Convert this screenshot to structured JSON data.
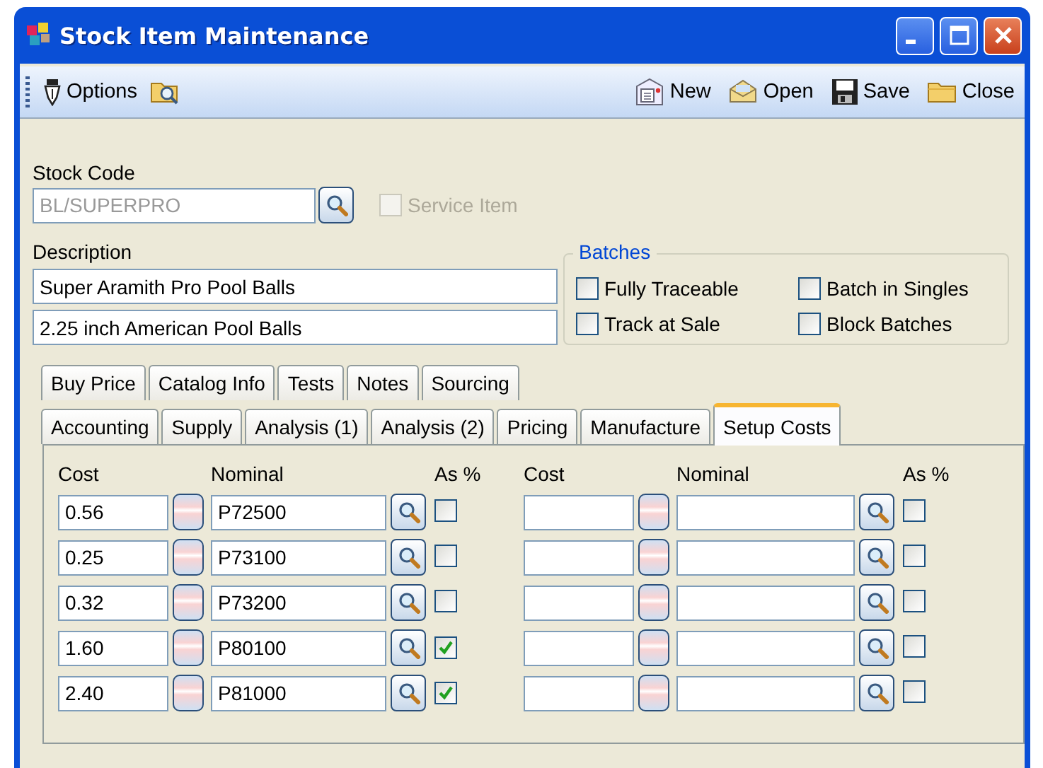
{
  "window": {
    "title": "Stock Item Maintenance"
  },
  "toolbar": {
    "left": [
      {
        "kind": "options",
        "label": "Options"
      },
      {
        "kind": "find"
      }
    ],
    "right": [
      {
        "kind": "new",
        "label": "New"
      },
      {
        "kind": "open",
        "label": "Open"
      },
      {
        "kind": "save",
        "label": "Save"
      },
      {
        "kind": "close",
        "label": "Close"
      }
    ]
  },
  "stock_code": {
    "label": "Stock Code",
    "value": "BL/SUPERPRO",
    "disabled": true
  },
  "service_item": {
    "label": "Service Item",
    "checked": false,
    "disabled": true
  },
  "description": {
    "label": "Description",
    "lines": [
      "Super Aramith Pro Pool Balls",
      "2.25 inch American Pool Balls"
    ]
  },
  "batches": {
    "title": "Batches",
    "options": [
      {
        "label": "Fully Traceable",
        "checked": false
      },
      {
        "label": "Batch in Singles",
        "checked": false
      },
      {
        "label": "Track at Sale",
        "checked": false
      },
      {
        "label": "Block Batches",
        "checked": false
      }
    ]
  },
  "tab_rows": [
    [
      {
        "label": "Buy Price",
        "selected": false
      },
      {
        "label": "Catalog Info",
        "selected": false
      },
      {
        "label": "Tests",
        "selected": false
      },
      {
        "label": "Notes",
        "selected": false
      },
      {
        "label": "Sourcing",
        "selected": false
      }
    ],
    [
      {
        "label": "Accounting",
        "selected": false
      },
      {
        "label": "Supply",
        "selected": false
      },
      {
        "label": "Analysis (1)",
        "selected": false
      },
      {
        "label": "Analysis (2)",
        "selected": false
      },
      {
        "label": "Pricing",
        "selected": false
      },
      {
        "label": "Manufacture",
        "selected": false
      },
      {
        "label": "Setup Costs",
        "selected": true
      }
    ]
  ],
  "setup_costs": {
    "columns": [
      "Cost",
      "Nominal",
      "As %",
      "Cost",
      "Nominal",
      "As %"
    ],
    "rows": [
      {
        "left": {
          "cost": "0.56",
          "nominal": "P72500",
          "as_percent": false
        },
        "right": {
          "as_percent": false
        }
      },
      {
        "left": {
          "cost": "0.25",
          "nominal": "P73100",
          "as_percent": false
        },
        "right": {
          "as_percent": false
        }
      },
      {
        "left": {
          "cost": "0.32",
          "nominal": "P73200",
          "as_percent": false
        },
        "right": {
          "as_percent": false
        }
      },
      {
        "left": {
          "cost": "1.60",
          "nominal": "P80100",
          "as_percent": true
        },
        "right": {
          "as_percent": false
        }
      },
      {
        "left": {
          "cost": "2.40",
          "nominal": "P81000",
          "as_percent": true
        },
        "right": {
          "as_percent": false
        }
      }
    ]
  }
}
